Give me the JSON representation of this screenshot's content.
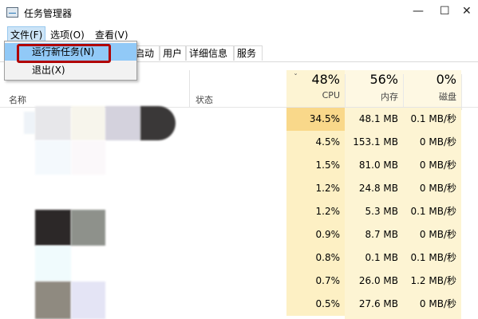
{
  "window": {
    "title": "任务管理器",
    "controls": [
      "—",
      "☐",
      "✕"
    ]
  },
  "menubar": {
    "items": [
      "文件(F)",
      "选项(O)",
      "查看(V)"
    ]
  },
  "file_menu": {
    "items": [
      "运行新任务(N)",
      "退出(X)"
    ]
  },
  "tabs": [
    "启动",
    "用户",
    "详细信息",
    "服务"
  ],
  "columns": {
    "name": "名称",
    "status": "状态",
    "cpu": {
      "percent": "48%",
      "label": "CPU"
    },
    "memory": {
      "percent": "56%",
      "label": "内存"
    },
    "disk": {
      "percent": "0%",
      "label": "磁盘"
    },
    "sort_indicator": "ˇ"
  },
  "rows": [
    {
      "cpu": "34.5%",
      "mem": "48.1 MB",
      "disk": "0.1 MB/秒",
      "cpu_bg": "#f9d88a"
    },
    {
      "cpu": "4.5%",
      "mem": "153.1 MB",
      "disk": "0 MB/秒",
      "cpu_bg": "#fdf0c4"
    },
    {
      "cpu": "1.5%",
      "mem": "81.0 MB",
      "disk": "0 MB/秒",
      "cpu_bg": "#fdf0c4"
    },
    {
      "cpu": "1.2%",
      "mem": "24.8 MB",
      "disk": "0 MB/秒",
      "cpu_bg": "#fdf0c4"
    },
    {
      "cpu": "1.2%",
      "mem": "5.3 MB",
      "disk": "0.1 MB/秒",
      "cpu_bg": "#fdf0c4"
    },
    {
      "cpu": "0.9%",
      "mem": "8.7 MB",
      "disk": "0 MB/秒",
      "cpu_bg": "#fdf0c4"
    },
    {
      "cpu": "0.8%",
      "mem": "0.1 MB",
      "disk": "0.1 MB/秒",
      "cpu_bg": "#fdf0c4"
    },
    {
      "cpu": "0.7%",
      "mem": "26.0 MB",
      "disk": "1.2 MB/秒",
      "cpu_bg": "#fdf0c4"
    },
    {
      "cpu": "0.5%",
      "mem": "27.6 MB",
      "disk": "0 MB/秒",
      "cpu_bg": "#fdf0c4"
    }
  ],
  "colors": {
    "highlight_border": "#b00000",
    "menu_selected": "#91c9f7",
    "column_tint": "#fdf4d3"
  }
}
